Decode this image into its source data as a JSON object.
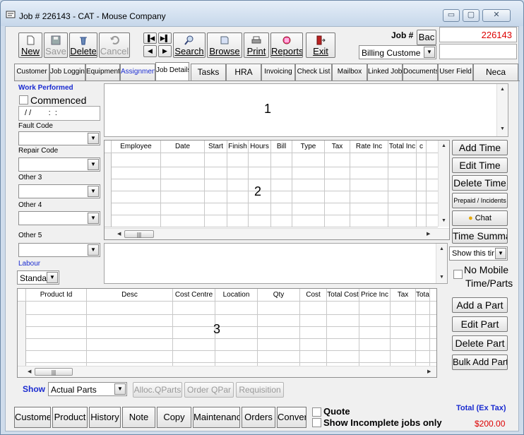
{
  "window": {
    "title": "Job # 226143 - CAT - Mouse Company",
    "controls": {
      "minimize": "▭",
      "maximize": "▢",
      "close": "✕"
    }
  },
  "toolbar": {
    "new_label": "New",
    "save_label": "Save",
    "delete_label": "Delete",
    "cancel_label": "Cancel",
    "search_label": "Search",
    "browse_label": "Browse",
    "print_label": "Print",
    "reports_label": "Reports",
    "exit_label": "Exit",
    "job_label": "Job #",
    "back_label": "Bac",
    "job_number": "226143",
    "billing_customer": "Billing Custome"
  },
  "tabs": [
    {
      "label": "Customer"
    },
    {
      "label": "Job Loggin"
    },
    {
      "label": "Equipment"
    },
    {
      "label": "Assignmen"
    },
    {
      "label": "Job Details"
    },
    {
      "label": "Tasks"
    },
    {
      "label": "HRA"
    },
    {
      "label": "Invoicing"
    },
    {
      "label": "Check List"
    },
    {
      "label": "Mailbox"
    },
    {
      "label": "Linked Job"
    },
    {
      "label": "Documents"
    },
    {
      "label": "User Field"
    },
    {
      "label": "Neca"
    }
  ],
  "left_panel": {
    "work_performed": "Work Performed",
    "commenced": "Commenced",
    "date_value": " / /        :  :",
    "fault_code": "Fault Code",
    "repair_code": "Repair Code",
    "other3": "Other 3",
    "other4": "Other 4",
    "other5": "Other 5",
    "labour": "Labour",
    "labour_value": "Standa"
  },
  "markers": {
    "one": "1",
    "two": "2",
    "three": "3"
  },
  "time_grid": {
    "columns": [
      "Employee",
      "Date",
      "Start",
      "Finish",
      "Hours",
      "Bill",
      "Type",
      "Tax",
      "Rate Inc",
      "Total Inc",
      "c"
    ]
  },
  "time_buttons": {
    "add": "Add Time",
    "edit": "Edit Time",
    "delete": "Delete Time",
    "prepaid": "Prepaid / Incidents",
    "chat": "Chat",
    "summary": "Time Summa"
  },
  "show_this": "Show this tir",
  "no_mobile": "No Mobile",
  "time_parts": "Time/Parts",
  "parts_grid": {
    "columns": [
      "Product Id",
      "Desc",
      "Cost Centre",
      "Location",
      "Qty",
      "Cost",
      "Total Cost",
      "Price Inc",
      "Tax",
      "Total"
    ]
  },
  "part_buttons": {
    "add": "Add a Part",
    "edit": "Edit Part",
    "delete": "Delete Part",
    "bulk": "Bulk Add Parts"
  },
  "show_row": {
    "label": "Show",
    "value": "Actual Parts",
    "alloc": "Alloc.QParts",
    "order": "Order QPar",
    "requisition": "Requisition"
  },
  "bottom_tabs": [
    {
      "label": "Custome"
    },
    {
      "label": "Product"
    },
    {
      "label": "History"
    },
    {
      "label": "Note"
    },
    {
      "label": "Copy"
    },
    {
      "label": "Maintenanc"
    },
    {
      "label": "Orders"
    },
    {
      "label": "Conver"
    }
  ],
  "quote_label": "Quote",
  "show_incomplete": "Show Incomplete jobs only",
  "total_label": "Total (Ex Tax)",
  "total_value": "$200.00"
}
